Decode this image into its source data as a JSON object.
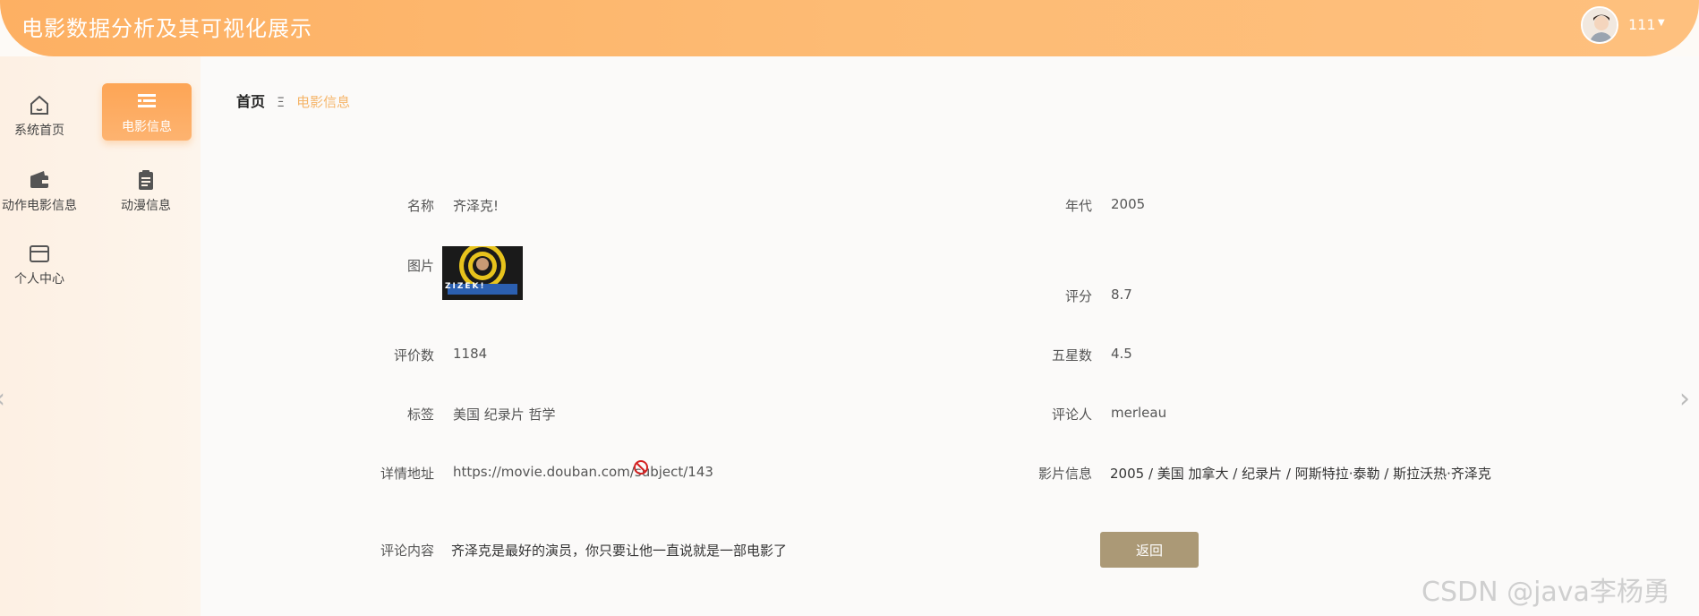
{
  "header": {
    "title": "电影数据分析及其可视化展示",
    "username": "111"
  },
  "sidebar": {
    "items": [
      {
        "label": "系统首页",
        "icon": "home-icon"
      },
      {
        "label": "电影信息",
        "icon": "list-icon",
        "active": true
      },
      {
        "label": "动作电影信息",
        "icon": "wallet-icon"
      },
      {
        "label": "动漫信息",
        "icon": "clipboard-icon"
      },
      {
        "label": "个人中心",
        "icon": "card-icon"
      }
    ]
  },
  "breadcrumb": {
    "home": "首页",
    "separator": "Ξ",
    "current": "电影信息"
  },
  "detail": {
    "name_label": "名称",
    "name_value": "齐泽克!",
    "year_label": "年代",
    "year_value": "2005",
    "image_label": "图片",
    "poster_text": "ZIZEK!",
    "rating_label": "评分",
    "rating_value": "8.7",
    "reviews_label": "评价数",
    "reviews_value": "1184",
    "fivestar_label": "五星数",
    "fivestar_value": "4.5",
    "tags_label": "标签",
    "tags_value": "美国 纪录片 哲学",
    "reviewer_label": "评论人",
    "reviewer_value": "merleau",
    "url_label": "详情地址",
    "url_value": "https://movie.douban.com/subject/143",
    "info_label": "影片信息",
    "info_value": "2005 / 美国 加拿大 / 纪录片 / 阿斯特拉·泰勒 / 斯拉沃热·齐泽克",
    "comment_label": "评论内容",
    "comment_value": "齐泽克是最好的演员，你只要让他一直说就是一部电影了",
    "back_button": "返回"
  },
  "watermark": "CSDN @java李杨勇",
  "colors": {
    "accent": "#fdb063",
    "button": "#ab9976",
    "breadcrumb_current": "#f5b56a"
  }
}
